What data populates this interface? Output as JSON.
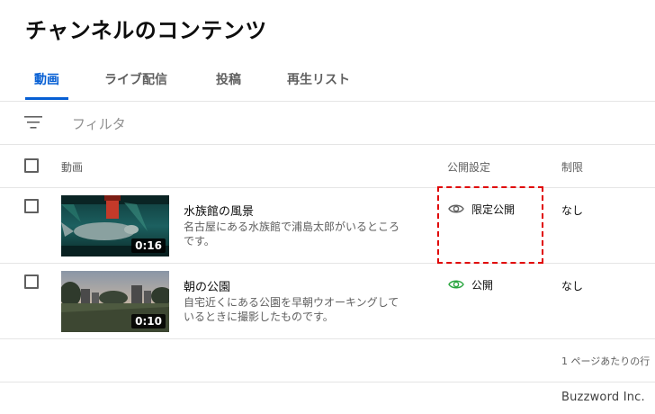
{
  "page_title": "チャンネルのコンテンツ",
  "tabs": [
    {
      "label": "動画",
      "active": true
    },
    {
      "label": "ライブ配信",
      "active": false
    },
    {
      "label": "投稿",
      "active": false
    },
    {
      "label": "再生リスト",
      "active": false
    }
  ],
  "filter": {
    "icon": "filter-lines-icon",
    "label": "フィルタ"
  },
  "table": {
    "headers": {
      "video": "動画",
      "visibility": "公開設定",
      "restrictions": "制限"
    },
    "rows": [
      {
        "title": "水族館の風景",
        "description": "名古屋にある水族館で浦島太郎がいるところです。",
        "duration": "0:16",
        "visibility": "限定公開",
        "visibility_icon": "eye-icon",
        "visibility_color": "#606060",
        "restrictions": "なし"
      },
      {
        "title": "朝の公園",
        "description": "自宅近くにある公園を早朝ウオーキングしているときに撮影したものです。",
        "duration": "0:10",
        "visibility": "公開",
        "visibility_icon": "eye-icon",
        "visibility_color": "#2ba640",
        "restrictions": "なし"
      }
    ]
  },
  "footer": {
    "rows_per_page_label": "1 ページあたりの行"
  },
  "watermark": "Buzzword Inc.",
  "colors": {
    "accent": "#065fd4",
    "highlight": "#e00000",
    "public_green": "#2ba640"
  }
}
